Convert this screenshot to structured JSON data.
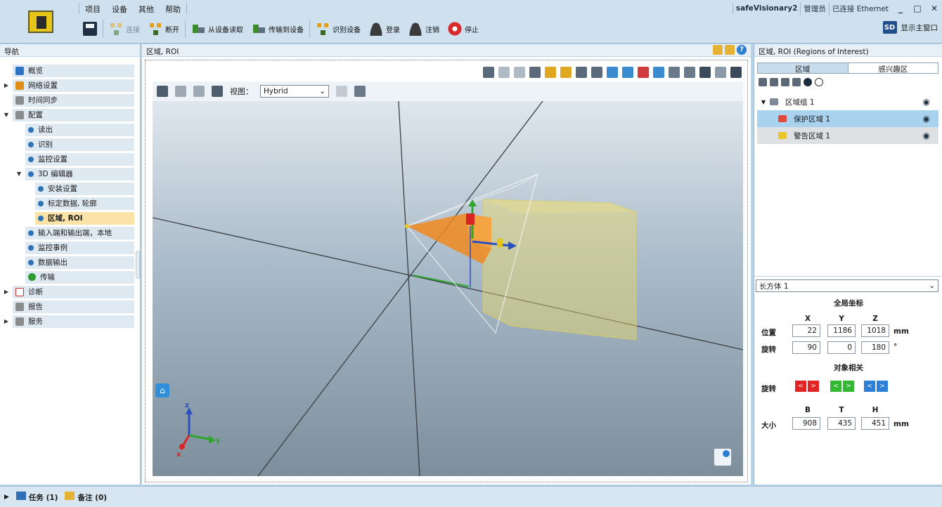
{
  "menu": [
    "项目",
    "设备",
    "其他",
    "帮助"
  ],
  "status": {
    "device": "safeVisionary2",
    "role": "管理员",
    "connection": "已连接 Ethernet"
  },
  "window_buttons": [
    "_",
    "□",
    "✕"
  ],
  "toolbar": {
    "connect": "连接",
    "disconnect": "断开",
    "read_from_device": "从设备读取",
    "transfer_to_device": "传输到设备",
    "identify_device": "识别设备",
    "login": "登录",
    "logout": "注销",
    "stop": "停止",
    "show_main_window": "显示主窗口",
    "sd_label": "SD"
  },
  "nav": {
    "title": "导航",
    "items": [
      {
        "label": "概览"
      },
      {
        "label": "网络设置"
      },
      {
        "label": "时间同步"
      },
      {
        "label": "配置"
      },
      {
        "label": "读出"
      },
      {
        "label": "识别"
      },
      {
        "label": "监控设置"
      },
      {
        "label": "3D 编辑器"
      },
      {
        "label": "安装设置"
      },
      {
        "label": "标定数据, 轮廓"
      },
      {
        "label": "区域, ROI"
      },
      {
        "label": "输入端和输出端，本地"
      },
      {
        "label": "监控事例"
      },
      {
        "label": "数据输出"
      },
      {
        "label": "传输"
      },
      {
        "label": "诊断"
      },
      {
        "label": "报告"
      },
      {
        "label": "服务"
      }
    ]
  },
  "center": {
    "title": "区域, ROI",
    "view_label": "视图：",
    "view_value": "Hybrid",
    "axes": {
      "x": "x",
      "y": "y",
      "z": "z"
    }
  },
  "right": {
    "title": "区域, ROI (Regions of Interest)",
    "tabs": [
      "区域",
      "感兴趣区"
    ],
    "tree": [
      {
        "label": "区域组 1"
      },
      {
        "label": "保护区域 1"
      },
      {
        "label": "警告区域 1"
      }
    ],
    "shape": "长方体 1",
    "global_coords_title": "全局坐标",
    "coord_headers": [
      "X",
      "Y",
      "Z"
    ],
    "position_label": "位置",
    "position": [
      "22",
      "1186",
      "1018"
    ],
    "rotation_label": "旋转",
    "rotation": [
      "90",
      "0",
      "180"
    ],
    "unit_mm": "mm",
    "unit_deg": "°",
    "object_rel_title": "对象相关",
    "rel_rotation_label": "旋转",
    "rel_buttons": [
      "<",
      ">"
    ],
    "size_headers": [
      "B",
      "T",
      "H"
    ],
    "size_label": "大小",
    "size": [
      "908",
      "435",
      "451"
    ],
    "colors": {
      "red": "#e22424",
      "green": "#33b833",
      "blue": "#2e7fd8"
    }
  },
  "bottom": {
    "tasks": "任务 (1)",
    "notes": "备注 (0)"
  }
}
